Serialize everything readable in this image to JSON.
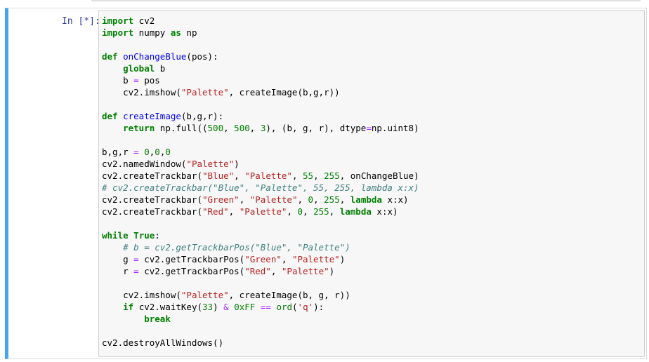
{
  "prompt": "In [*]:",
  "code_lines": [
    [
      {
        "t": "import",
        "c": "kw"
      },
      {
        "t": " cv2",
        "c": ""
      }
    ],
    [
      {
        "t": "import",
        "c": "kw"
      },
      {
        "t": " numpy ",
        "c": ""
      },
      {
        "t": "as",
        "c": "kw"
      },
      {
        "t": " np",
        "c": ""
      }
    ],
    [],
    [
      {
        "t": "def",
        "c": "kw"
      },
      {
        "t": " ",
        "c": ""
      },
      {
        "t": "onChangeBlue",
        "c": "fn"
      },
      {
        "t": "(pos):",
        "c": ""
      }
    ],
    [
      {
        "t": "    ",
        "c": ""
      },
      {
        "t": "global",
        "c": "kw"
      },
      {
        "t": " b",
        "c": ""
      }
    ],
    [
      {
        "t": "    b ",
        "c": ""
      },
      {
        "t": "=",
        "c": "op"
      },
      {
        "t": " pos",
        "c": ""
      }
    ],
    [
      {
        "t": "    cv2.imshow(",
        "c": ""
      },
      {
        "t": "\"Palette\"",
        "c": "str"
      },
      {
        "t": ", createImage(b,g,r))",
        "c": ""
      }
    ],
    [],
    [
      {
        "t": "def",
        "c": "kw"
      },
      {
        "t": " ",
        "c": ""
      },
      {
        "t": "createImage",
        "c": "fn"
      },
      {
        "t": "(b,g,r):",
        "c": ""
      }
    ],
    [
      {
        "t": "    ",
        "c": ""
      },
      {
        "t": "return",
        "c": "kw"
      },
      {
        "t": " np.full((",
        "c": ""
      },
      {
        "t": "500",
        "c": "num"
      },
      {
        "t": ", ",
        "c": ""
      },
      {
        "t": "500",
        "c": "num"
      },
      {
        "t": ", ",
        "c": ""
      },
      {
        "t": "3",
        "c": "num"
      },
      {
        "t": "), (b, g, r), dtype",
        "c": ""
      },
      {
        "t": "=",
        "c": "op"
      },
      {
        "t": "np.uint8)",
        "c": ""
      }
    ],
    [],
    [
      {
        "t": "b,g,r ",
        "c": ""
      },
      {
        "t": "=",
        "c": "op"
      },
      {
        "t": " ",
        "c": ""
      },
      {
        "t": "0",
        "c": "num"
      },
      {
        "t": ",",
        "c": ""
      },
      {
        "t": "0",
        "c": "num"
      },
      {
        "t": ",",
        "c": ""
      },
      {
        "t": "0",
        "c": "num"
      }
    ],
    [
      {
        "t": "cv2.namedWindow(",
        "c": ""
      },
      {
        "t": "\"Palette\"",
        "c": "str"
      },
      {
        "t": ")",
        "c": ""
      }
    ],
    [
      {
        "t": "cv2.createTrackbar(",
        "c": ""
      },
      {
        "t": "\"Blue\"",
        "c": "str"
      },
      {
        "t": ", ",
        "c": ""
      },
      {
        "t": "\"Palette\"",
        "c": "str"
      },
      {
        "t": ", ",
        "c": ""
      },
      {
        "t": "55",
        "c": "num"
      },
      {
        "t": ", ",
        "c": ""
      },
      {
        "t": "255",
        "c": "num"
      },
      {
        "t": ", onChangeBlue)",
        "c": ""
      }
    ],
    [
      {
        "t": "# cv2.createTrackbar(\"Blue\", \"Palette\", 55, 255, lambda x:x)",
        "c": "cm"
      }
    ],
    [
      {
        "t": "cv2.createTrackbar(",
        "c": ""
      },
      {
        "t": "\"Green\"",
        "c": "str"
      },
      {
        "t": ", ",
        "c": ""
      },
      {
        "t": "\"Palette\"",
        "c": "str"
      },
      {
        "t": ", ",
        "c": ""
      },
      {
        "t": "0",
        "c": "num"
      },
      {
        "t": ", ",
        "c": ""
      },
      {
        "t": "255",
        "c": "num"
      },
      {
        "t": ", ",
        "c": ""
      },
      {
        "t": "lambda",
        "c": "kw"
      },
      {
        "t": " x:x)",
        "c": ""
      }
    ],
    [
      {
        "t": "cv2.createTrackbar(",
        "c": ""
      },
      {
        "t": "\"Red\"",
        "c": "str"
      },
      {
        "t": ", ",
        "c": ""
      },
      {
        "t": "\"Palette\"",
        "c": "str"
      },
      {
        "t": ", ",
        "c": ""
      },
      {
        "t": "0",
        "c": "num"
      },
      {
        "t": ", ",
        "c": ""
      },
      {
        "t": "255",
        "c": "num"
      },
      {
        "t": ", ",
        "c": ""
      },
      {
        "t": "lambda",
        "c": "kw"
      },
      {
        "t": " x:x)",
        "c": ""
      }
    ],
    [],
    [
      {
        "t": "while",
        "c": "kw"
      },
      {
        "t": " ",
        "c": ""
      },
      {
        "t": "True",
        "c": "kw"
      },
      {
        "t": ":",
        "c": ""
      }
    ],
    [
      {
        "t": "    ",
        "c": ""
      },
      {
        "t": "# b = cv2.getTrackbarPos(\"Blue\", \"Palette\")",
        "c": "cm"
      }
    ],
    [
      {
        "t": "    g ",
        "c": ""
      },
      {
        "t": "=",
        "c": "op"
      },
      {
        "t": " cv2.getTrackbarPos(",
        "c": ""
      },
      {
        "t": "\"Green\"",
        "c": "str"
      },
      {
        "t": ", ",
        "c": ""
      },
      {
        "t": "\"Palette\"",
        "c": "str"
      },
      {
        "t": ")",
        "c": ""
      }
    ],
    [
      {
        "t": "    r ",
        "c": ""
      },
      {
        "t": "=",
        "c": "op"
      },
      {
        "t": " cv2.getTrackbarPos(",
        "c": ""
      },
      {
        "t": "\"Red\"",
        "c": "str"
      },
      {
        "t": ", ",
        "c": ""
      },
      {
        "t": "\"Palette\"",
        "c": "str"
      },
      {
        "t": ")",
        "c": ""
      }
    ],
    [],
    [
      {
        "t": "    cv2.imshow(",
        "c": ""
      },
      {
        "t": "\"Palette\"",
        "c": "str"
      },
      {
        "t": ", createImage(b, g, r))",
        "c": ""
      }
    ],
    [
      {
        "t": "    ",
        "c": ""
      },
      {
        "t": "if",
        "c": "kw"
      },
      {
        "t": " cv2.waitKey(",
        "c": ""
      },
      {
        "t": "33",
        "c": "num"
      },
      {
        "t": ") ",
        "c": ""
      },
      {
        "t": "&",
        "c": "op"
      },
      {
        "t": " ",
        "c": ""
      },
      {
        "t": "0xFF",
        "c": "num"
      },
      {
        "t": " ",
        "c": ""
      },
      {
        "t": "==",
        "c": "op"
      },
      {
        "t": " ",
        "c": ""
      },
      {
        "t": "ord",
        "c": "num"
      },
      {
        "t": "(",
        "c": ""
      },
      {
        "t": "'q'",
        "c": "str"
      },
      {
        "t": "):",
        "c": ""
      }
    ],
    [
      {
        "t": "        ",
        "c": ""
      },
      {
        "t": "break",
        "c": "kw"
      }
    ],
    [],
    [
      {
        "t": "cv2.destroyAllWindows()",
        "c": ""
      }
    ]
  ],
  "colors": {
    "cell_border_active": "#42a5f5",
    "keyword": "#008000",
    "string": "#ba2121",
    "function_name": "#0000ff",
    "operator": "#aa22ff",
    "comment": "#408080",
    "prompt": "#303f9f"
  }
}
